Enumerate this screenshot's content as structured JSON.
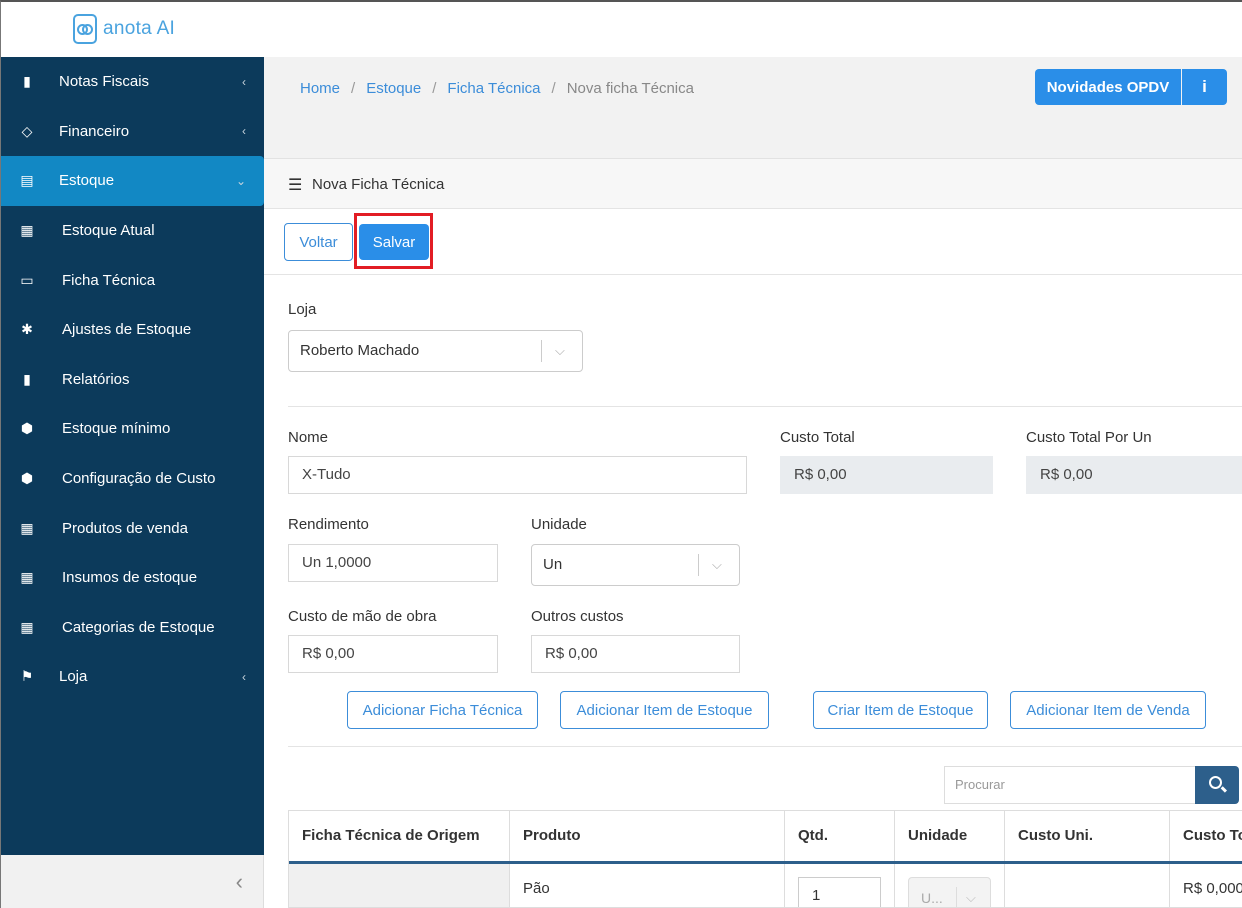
{
  "app": {
    "logo_text": "anota AI"
  },
  "sidebar": {
    "items": [
      {
        "label": "Notas Fiscais",
        "icon": "file-icon",
        "glyph": "▮"
      },
      {
        "label": "Financeiro",
        "icon": "diamond-icon",
        "glyph": "◇"
      },
      {
        "label": "Estoque",
        "icon": "book-icon",
        "glyph": "▤"
      },
      {
        "label": "Estoque Atual",
        "icon": "boxes-icon",
        "glyph": "▦"
      },
      {
        "label": "Ficha Técnica",
        "icon": "id-card-icon",
        "glyph": "▭"
      },
      {
        "label": "Ajustes de Estoque",
        "icon": "asterisk-icon",
        "glyph": "✱"
      },
      {
        "label": "Relatórios",
        "icon": "bookmark-icon",
        "glyph": "▮"
      },
      {
        "label": "Estoque mínimo",
        "icon": "cubes-icon",
        "glyph": "⬢"
      },
      {
        "label": "Configuração de Custo",
        "icon": "cubes-icon",
        "glyph": "⬢"
      },
      {
        "label": "Produtos de venda",
        "icon": "grid-icon",
        "glyph": "▦"
      },
      {
        "label": "Insumos de estoque",
        "icon": "grid-icon",
        "glyph": "▦"
      },
      {
        "label": "Categorias de Estoque",
        "icon": "grid-icon",
        "glyph": "▦"
      },
      {
        "label": "Loja",
        "icon": "checkered-flag-icon",
        "glyph": "⚑"
      }
    ],
    "collapse_glyph": "‹"
  },
  "breadcrumb": {
    "items": [
      "Home",
      "Estoque",
      "Ficha Técnica"
    ],
    "current": "Nova ficha Técnica",
    "separator": "/"
  },
  "header": {
    "novidades_label": "Novidades OPDV",
    "info_label": "i"
  },
  "card": {
    "title": "Nova Ficha Técnica"
  },
  "toolbar": {
    "voltar_label": "Voltar",
    "salvar_label": "Salvar"
  },
  "form": {
    "loja_label": "Loja",
    "loja_value": "Roberto Machado",
    "nome_label": "Nome",
    "nome_value": "X-Tudo",
    "custo_total_label": "Custo Total",
    "custo_total_value": "R$ 0,00",
    "custo_total_un_label": "Custo Total Por Un",
    "custo_total_un_value": "R$ 0,00",
    "rendimento_label": "Rendimento",
    "rendimento_value": "Un 1,0000",
    "unidade_label": "Unidade",
    "unidade_value": "Un",
    "mao_obra_label": "Custo de mão de obra",
    "mao_obra_value": "R$ 0,00",
    "outros_label": "Outros custos",
    "outros_value": "R$ 0,00"
  },
  "actions": {
    "adicionar_ficha": "Adicionar Ficha Técnica",
    "adicionar_item_estoque": "Adicionar Item de Estoque",
    "criar_item_estoque": "Criar Item de Estoque",
    "adicionar_item_venda": "Adicionar Item de Venda"
  },
  "search": {
    "placeholder": "Procurar"
  },
  "table": {
    "headers": [
      "Ficha Técnica de Origem",
      "Produto",
      "Qtd.",
      "Unidade",
      "Custo Uni.",
      "Custo To"
    ],
    "rows": [
      {
        "origem": "",
        "produto": "Pão",
        "qtd": "1",
        "unidade": "U...",
        "custo_uni": "",
        "custo_total": "R$ 0,000"
      }
    ]
  },
  "colors": {
    "sidebar_bg": "#0c3a5b",
    "active_item": "#1288c4",
    "primary": "#2a8ee8",
    "highlight_frame": "#e21d24"
  }
}
